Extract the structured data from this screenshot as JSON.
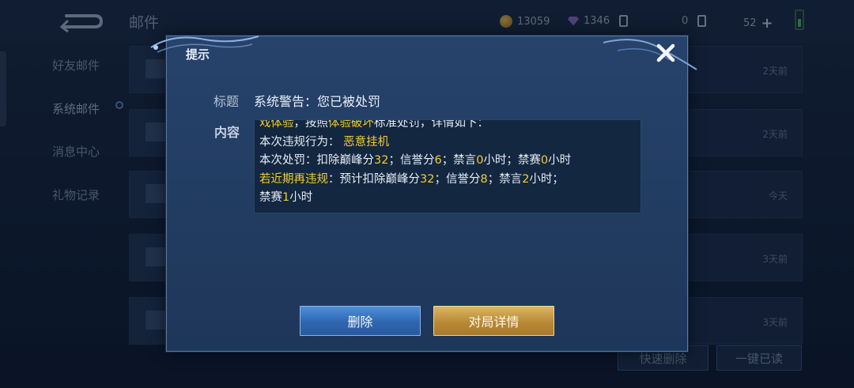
{
  "header": {
    "title": "邮件",
    "gold": "13059",
    "diamond": "1346",
    "tickets": "0",
    "level": "52"
  },
  "sidebar": {
    "items": [
      {
        "label": "好友邮件"
      },
      {
        "label": "系统邮件"
      },
      {
        "label": "消息中心"
      },
      {
        "label": "礼物记录"
      }
    ]
  },
  "mail_list": {
    "rows": [
      {
        "time": "2天前"
      },
      {
        "time": "2天前"
      },
      {
        "time": "今天"
      },
      {
        "time": "3天前"
      },
      {
        "time": "3天前"
      }
    ]
  },
  "bottom": {
    "quick_delete": "快速删除",
    "read_all": "一键已读"
  },
  "dialog": {
    "title": "提示",
    "subject_label": "标题",
    "subject": "系统警告：您已被处罚",
    "content_label": "内容",
    "content": {
      "line0_a": "戏体验",
      "line0_b": "，按照",
      "line0_c": "体验破坏",
      "line0_d": "标准处罚，详情如下：",
      "line1_a": "本次违规行为：",
      "line1_b": "恶意挂机",
      "line2_a": "本次处罚：扣除巅峰分",
      "line2_b": "32",
      "line2_c": "；信誉分",
      "line2_d": "6",
      "line2_e": "；禁言",
      "line2_f": "0",
      "line2_g": "小时；禁赛",
      "line2_h": "0",
      "line2_i": "小时",
      "line3_a": "若近期再违规",
      "line3_b": "：预计扣除巅峰分",
      "line3_c": "32",
      "line3_d": "；信誉分",
      "line3_e": "8",
      "line3_f": "；禁言",
      "line3_g": "2",
      "line3_h": "小时；",
      "line4_a": "禁赛",
      "line4_b": "1",
      "line4_c": "小时"
    },
    "delete_label": "删除",
    "details_label": "对局详情"
  }
}
